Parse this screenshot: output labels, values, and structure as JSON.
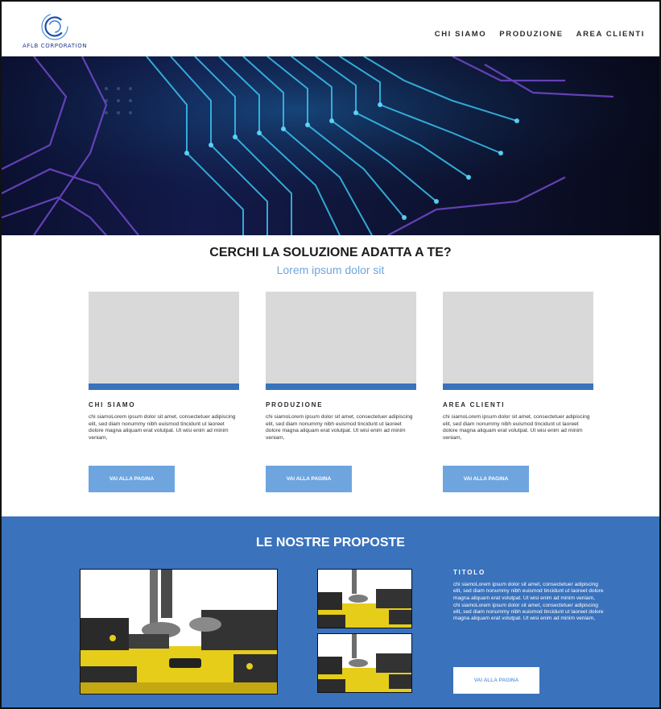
{
  "header": {
    "logo_text": "AFLB CORPORATION",
    "nav": [
      "CHI SIAMO",
      "PRODUZIONE",
      "AREA CLIENTI"
    ]
  },
  "solution": {
    "title": "CERCHI LA SOLUZIONE ADATTA A TE?",
    "subtitle": "Lorem ipsum dolor sit",
    "cards": [
      {
        "title": "CHI SIAMO",
        "text": "chi siamoLorem ipsum dolor sit amet, consectetuer adipiscing elit, sed diam nonummy nibh euismod tincidunt ut laoreet dolore magna aliquam erat volutpat. Ut wisi enim ad minim veniam,",
        "button": "VAI ALLA PAGINA"
      },
      {
        "title": "PRODUZIONE",
        "text": "chi siamoLorem ipsum dolor sit amet, consectetuer adipiscing elit, sed diam nonummy nibh euismod tincidunt ut laoreet dolore magna aliquam erat volutpat. Ut wisi enim ad minim veniam,",
        "button": "VAI ALLA PAGINA"
      },
      {
        "title": "AREA CLIENTI",
        "text": "chi siamoLorem ipsum dolor sit amet, consectetuer adipiscing elit, sed diam nonummy nibh euismod tincidunt ut laoreet dolore magna aliquam erat volutpat. Ut wisi enim ad minim veniam,",
        "button": "VAI ALLA PAGINA"
      }
    ]
  },
  "proposals": {
    "title": "LE NOSTRE PROPOSTE",
    "info_title": "TITOLO",
    "info_text_1": "chi siamoLorem ipsum dolor sit amet, consectetuer adipiscing elit, sed diam nonummy nibh euismod tincidunt ut laoreet dolore magna aliquam erat volutpat. Ut wisi enim ad minim veniam,",
    "info_text_2": "chi siamoLorem ipsum dolor sit amet, consectetuer adipiscing elit, sed diam nonummy nibh euismod tincidunt ut laoreet dolore magna aliquam erat volutpat. Ut wisi enim ad minim veniam,",
    "button": "VAI ALLA PAGINA"
  },
  "colors": {
    "brand_blue": "#3a72bc",
    "light_blue": "#6ea5df",
    "placeholder_gray": "#d9d9d9"
  },
  "icons": {
    "logo": "concentric-circles-logo-icon",
    "hero": "circuit-board-image",
    "photos": "machinery-photo"
  }
}
